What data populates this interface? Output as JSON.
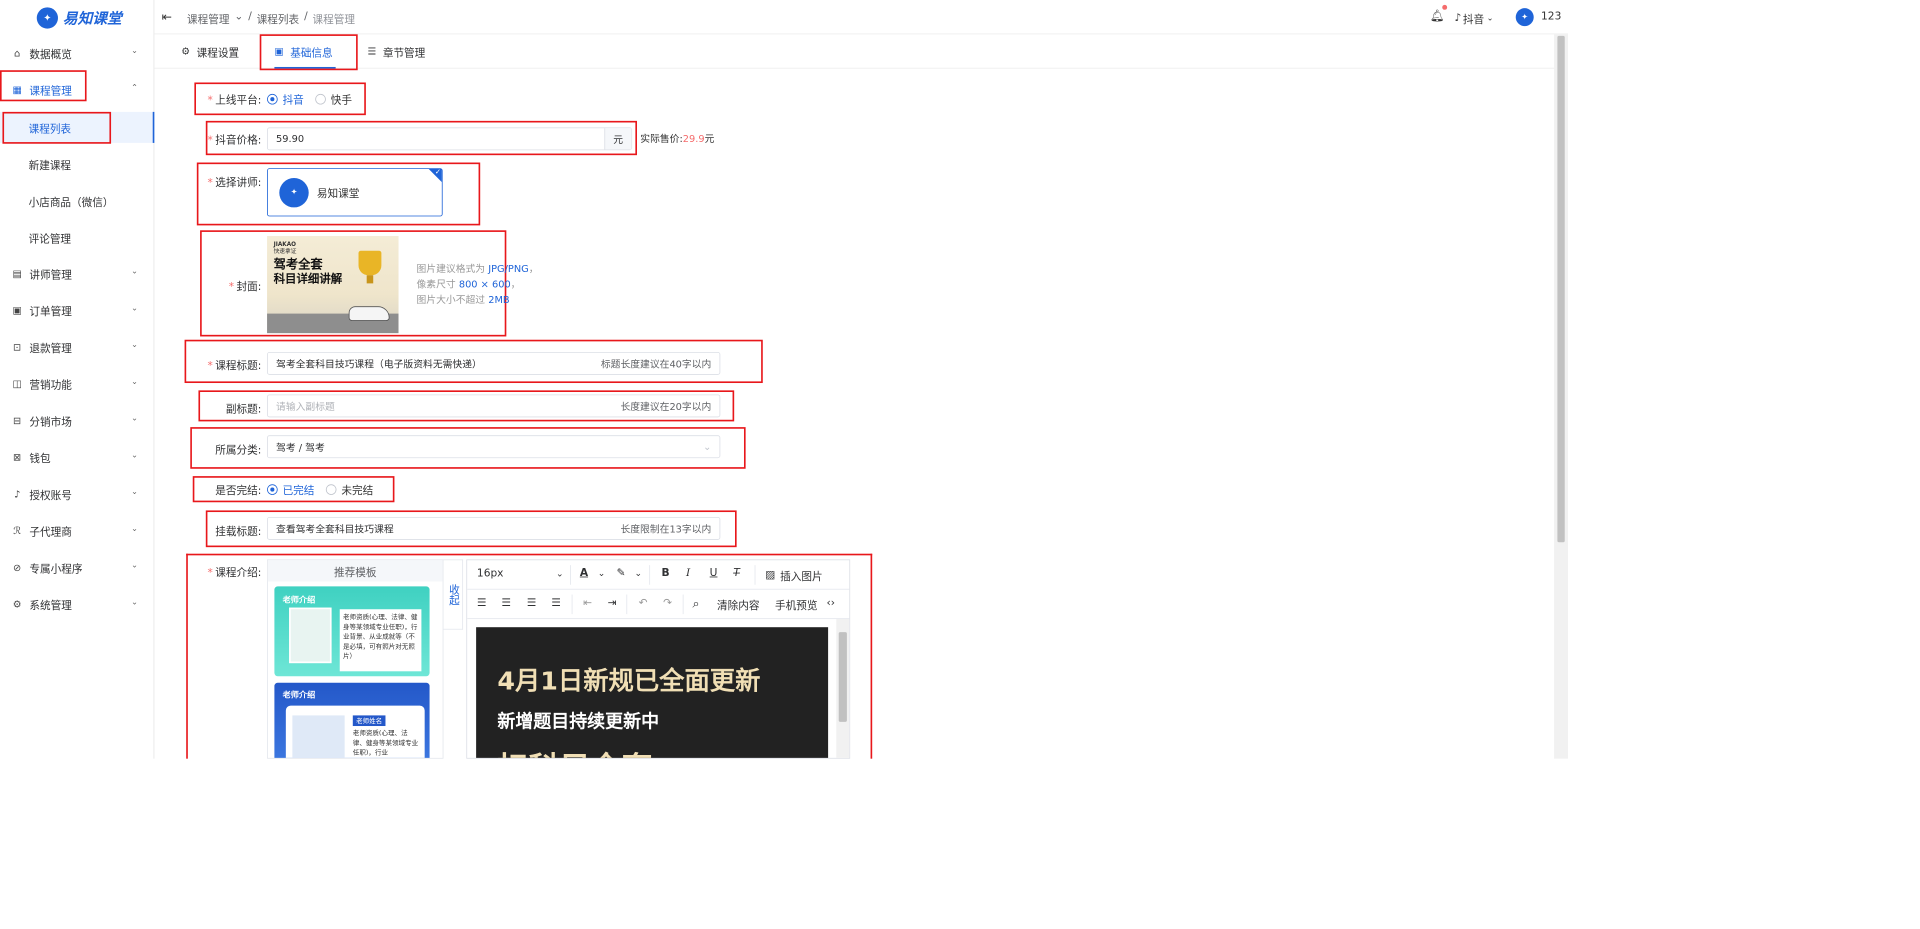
{
  "brand": {
    "name": "易知课堂",
    "color": "#1f64d8"
  },
  "sidebar": {
    "items": [
      {
        "label": "数据概览",
        "icon": "home-icon"
      },
      {
        "label": "课程管理",
        "icon": "grid-icon"
      },
      {
        "label": "讲师管理",
        "icon": "teacher-icon"
      },
      {
        "label": "订单管理",
        "icon": "order-icon"
      },
      {
        "label": "退款管理",
        "icon": "refund-icon"
      },
      {
        "label": "营销功能",
        "icon": "marketing-icon"
      },
      {
        "label": "分销市场",
        "icon": "distribution-icon"
      },
      {
        "label": "钱包",
        "icon": "wallet-icon"
      },
      {
        "label": "授权账号",
        "icon": "auth-icon"
      },
      {
        "label": "子代理商",
        "icon": "agent-icon"
      },
      {
        "label": "专属小程序",
        "icon": "miniapp-icon"
      },
      {
        "label": "系统管理",
        "icon": "settings-icon"
      }
    ],
    "course_sub": [
      "课程列表",
      "新建课程",
      "小店商品（微信）",
      "评论管理"
    ]
  },
  "header": {
    "breadcrumb": [
      "课程管理",
      "课程列表",
      "课程管理"
    ],
    "platform": "抖音",
    "user": "123"
  },
  "tabs": [
    {
      "label": "课程设置",
      "icon": "gear-icon"
    },
    {
      "label": "基础信息",
      "icon": "doc-icon"
    },
    {
      "label": "章节管理",
      "icon": "list-icon"
    }
  ],
  "form": {
    "platform": {
      "label": "上线平台:",
      "options": [
        "抖音",
        "快手"
      ],
      "selected": "抖音"
    },
    "price": {
      "label": "抖音价格:",
      "value": "59.90",
      "unit": "元",
      "actual_label": "实际售价:",
      "actual_value": "29.9",
      "actual_unit": "元"
    },
    "teacher": {
      "label": "选择讲师:",
      "name": "易知课堂"
    },
    "cover": {
      "label": "封面:",
      "hint_lines": [
        {
          "pre": "图片建议格式为 ",
          "hl": "JPG/PNG",
          "post": "，"
        },
        {
          "pre": "像素尺寸 ",
          "hl": "800 × 600",
          "post": "，"
        },
        {
          "pre": "图片大小不超过 ",
          "hl": "2MB",
          "post": ""
        }
      ],
      "image_text": {
        "top": "JIAKAO",
        "sub": "快速拿证",
        "line1": "驾考全套",
        "line2": "科目详细讲解"
      }
    },
    "title": {
      "label": "课程标题:",
      "value": "驾考全套科目技巧课程（电子版资料无需快递）",
      "hint": "标题长度建议在40字以内"
    },
    "subtitle": {
      "label": "副标题:",
      "placeholder": "请输入副标题",
      "hint": "长度建议在20字以内"
    },
    "category": {
      "label": "所属分类:",
      "value": "驾考 / 驾考"
    },
    "finished": {
      "label": "是否完结:",
      "options": [
        "已完结",
        "未完结"
      ],
      "selected": "已完结"
    },
    "mount": {
      "label": "挂载标题:",
      "value": "查看驾考全套科目技巧课程",
      "hint": "长度限制在13字以内"
    },
    "intro": {
      "label": "课程介绍:",
      "template_header": "推荐模板",
      "collapse": "收起",
      "templates": [
        {
          "title": "老师介绍",
          "text": "老师资质(心理、法律、健身等某领域专业任职)，行业背景、从业成就等（不是必填，可有照片对无照片）"
        },
        {
          "title": "老师介绍",
          "name_tag": "老师姓名",
          "text": "老师资质(心理、法律、健身等某领域专业任职)，行业"
        }
      ],
      "editor": {
        "font_size": "16px",
        "insert_image": "插入图片",
        "clear": "清除内容",
        "preview": "手机预览",
        "content_line1": "4月1日新规已全面更新",
        "content_line2": "新增题目持续更新中",
        "content_line3": "扣科目全套"
      }
    }
  }
}
